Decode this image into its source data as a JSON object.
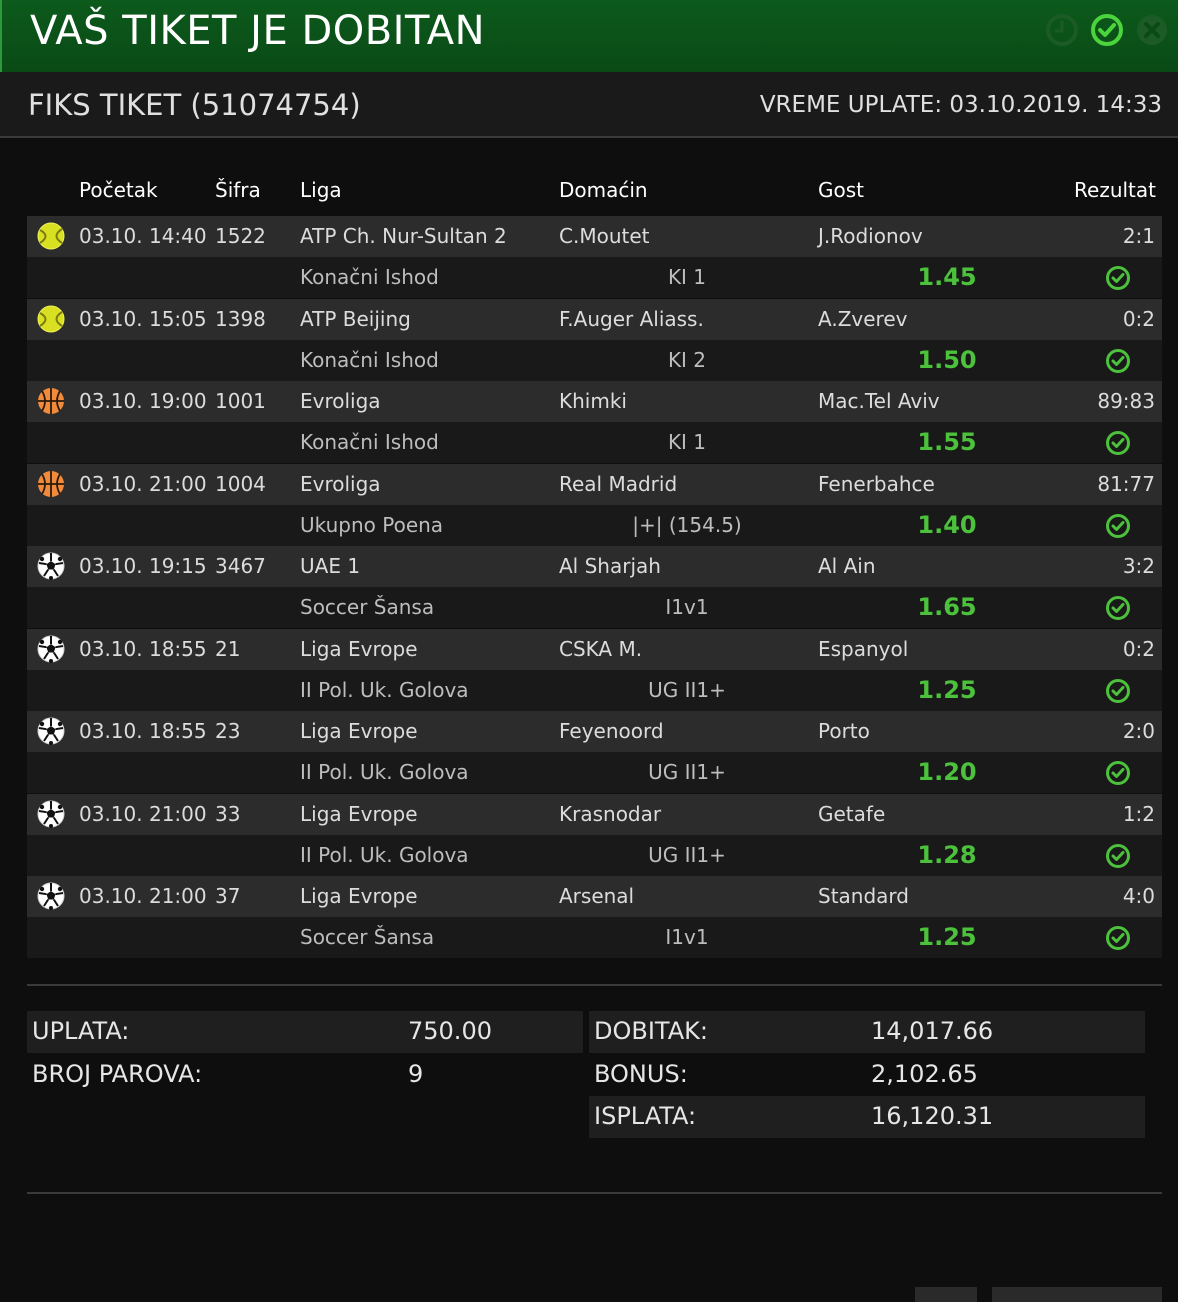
{
  "header": {
    "title": "VAŠ TIKET JE DOBITAN",
    "colors": {
      "bar": "#0a4a16",
      "accent": "#4cc23c"
    },
    "icons": [
      "clock-icon",
      "check-circle-icon",
      "close-icon"
    ]
  },
  "ticket": {
    "title": "FIKS TIKET (51074754)",
    "payment_time": "VREME UPLATE: 03.10.2019. 14:33"
  },
  "columns": {
    "start": "Početak",
    "code": "Šifra",
    "league": "Liga",
    "home": "Domaćin",
    "away": "Gost",
    "result": "Rezultat"
  },
  "matches": [
    {
      "sport": "tennis",
      "start": "03.10. 14:40",
      "code": "1522",
      "league": "ATP Ch. Nur-Sultan 2",
      "home": "C.Moutet",
      "away": "J.Rodionov",
      "result": "2:1",
      "market": "Konačni Ishod",
      "pick": "KI 1",
      "odd": "1.45",
      "status": "won"
    },
    {
      "sport": "tennis",
      "start": "03.10. 15:05",
      "code": "1398",
      "league": "ATP Beijing",
      "home": "F.Auger Aliass.",
      "away": "A.Zverev",
      "result": "0:2",
      "market": "Konačni Ishod",
      "pick": "KI 2",
      "odd": "1.50",
      "status": "won"
    },
    {
      "sport": "basketball",
      "start": "03.10. 19:00",
      "code": "1001",
      "league": "Evroliga",
      "home": "Khimki",
      "away": "Mac.Tel Aviv",
      "result": "89:83",
      "market": "Konačni Ishod",
      "pick": "KI 1",
      "odd": "1.55",
      "status": "won"
    },
    {
      "sport": "basketball",
      "start": "03.10. 21:00",
      "code": "1004",
      "league": "Evroliga",
      "home": "Real Madrid",
      "away": "Fenerbahce",
      "result": "81:77",
      "market": "Ukupno Poena",
      "pick": "|+| (154.5)",
      "odd": "1.40",
      "status": "won"
    },
    {
      "sport": "soccer",
      "start": "03.10. 19:15",
      "code": "3467",
      "league": "UAE 1",
      "home": "Al Sharjah",
      "away": "Al Ain",
      "result": "3:2",
      "market": "Soccer Šansa",
      "pick": "I1v1",
      "odd": "1.65",
      "status": "won"
    },
    {
      "sport": "soccer",
      "start": "03.10. 18:55",
      "code": "21",
      "league": "Liga Evrope",
      "home": "CSKA M.",
      "away": "Espanyol",
      "result": "0:2",
      "market": "II Pol. Uk. Golova",
      "pick": "UG II1+",
      "odd": "1.25",
      "status": "won"
    },
    {
      "sport": "soccer",
      "start": "03.10. 18:55",
      "code": "23",
      "league": "Liga Evrope",
      "home": "Feyenoord",
      "away": "Porto",
      "result": "2:0",
      "market": "II Pol. Uk. Golova",
      "pick": "UG II1+",
      "odd": "1.20",
      "status": "won"
    },
    {
      "sport": "soccer",
      "start": "03.10. 21:00",
      "code": "33",
      "league": "Liga Evrope",
      "home": "Krasnodar",
      "away": "Getafe",
      "result": "1:2",
      "market": "II Pol. Uk. Golova",
      "pick": "UG II1+",
      "odd": "1.28",
      "status": "won"
    },
    {
      "sport": "soccer",
      "start": "03.10. 21:00",
      "code": "37",
      "league": "Liga Evrope",
      "home": "Arsenal",
      "away": "Standard",
      "result": "4:0",
      "market": "Soccer Šansa",
      "pick": "I1v1",
      "odd": "1.25",
      "status": "won"
    }
  ],
  "summary": {
    "stake_label": "UPLATA:",
    "stake": "750.00",
    "pairs_label": "BROJ PAROVA:",
    "pairs": "9",
    "win_label": "DOBITAK:",
    "win": "14,017.66",
    "bonus_label": "BONUS:",
    "bonus": "2,102.65",
    "payout_label": "ISPLATA:",
    "payout": "16,120.31"
  }
}
